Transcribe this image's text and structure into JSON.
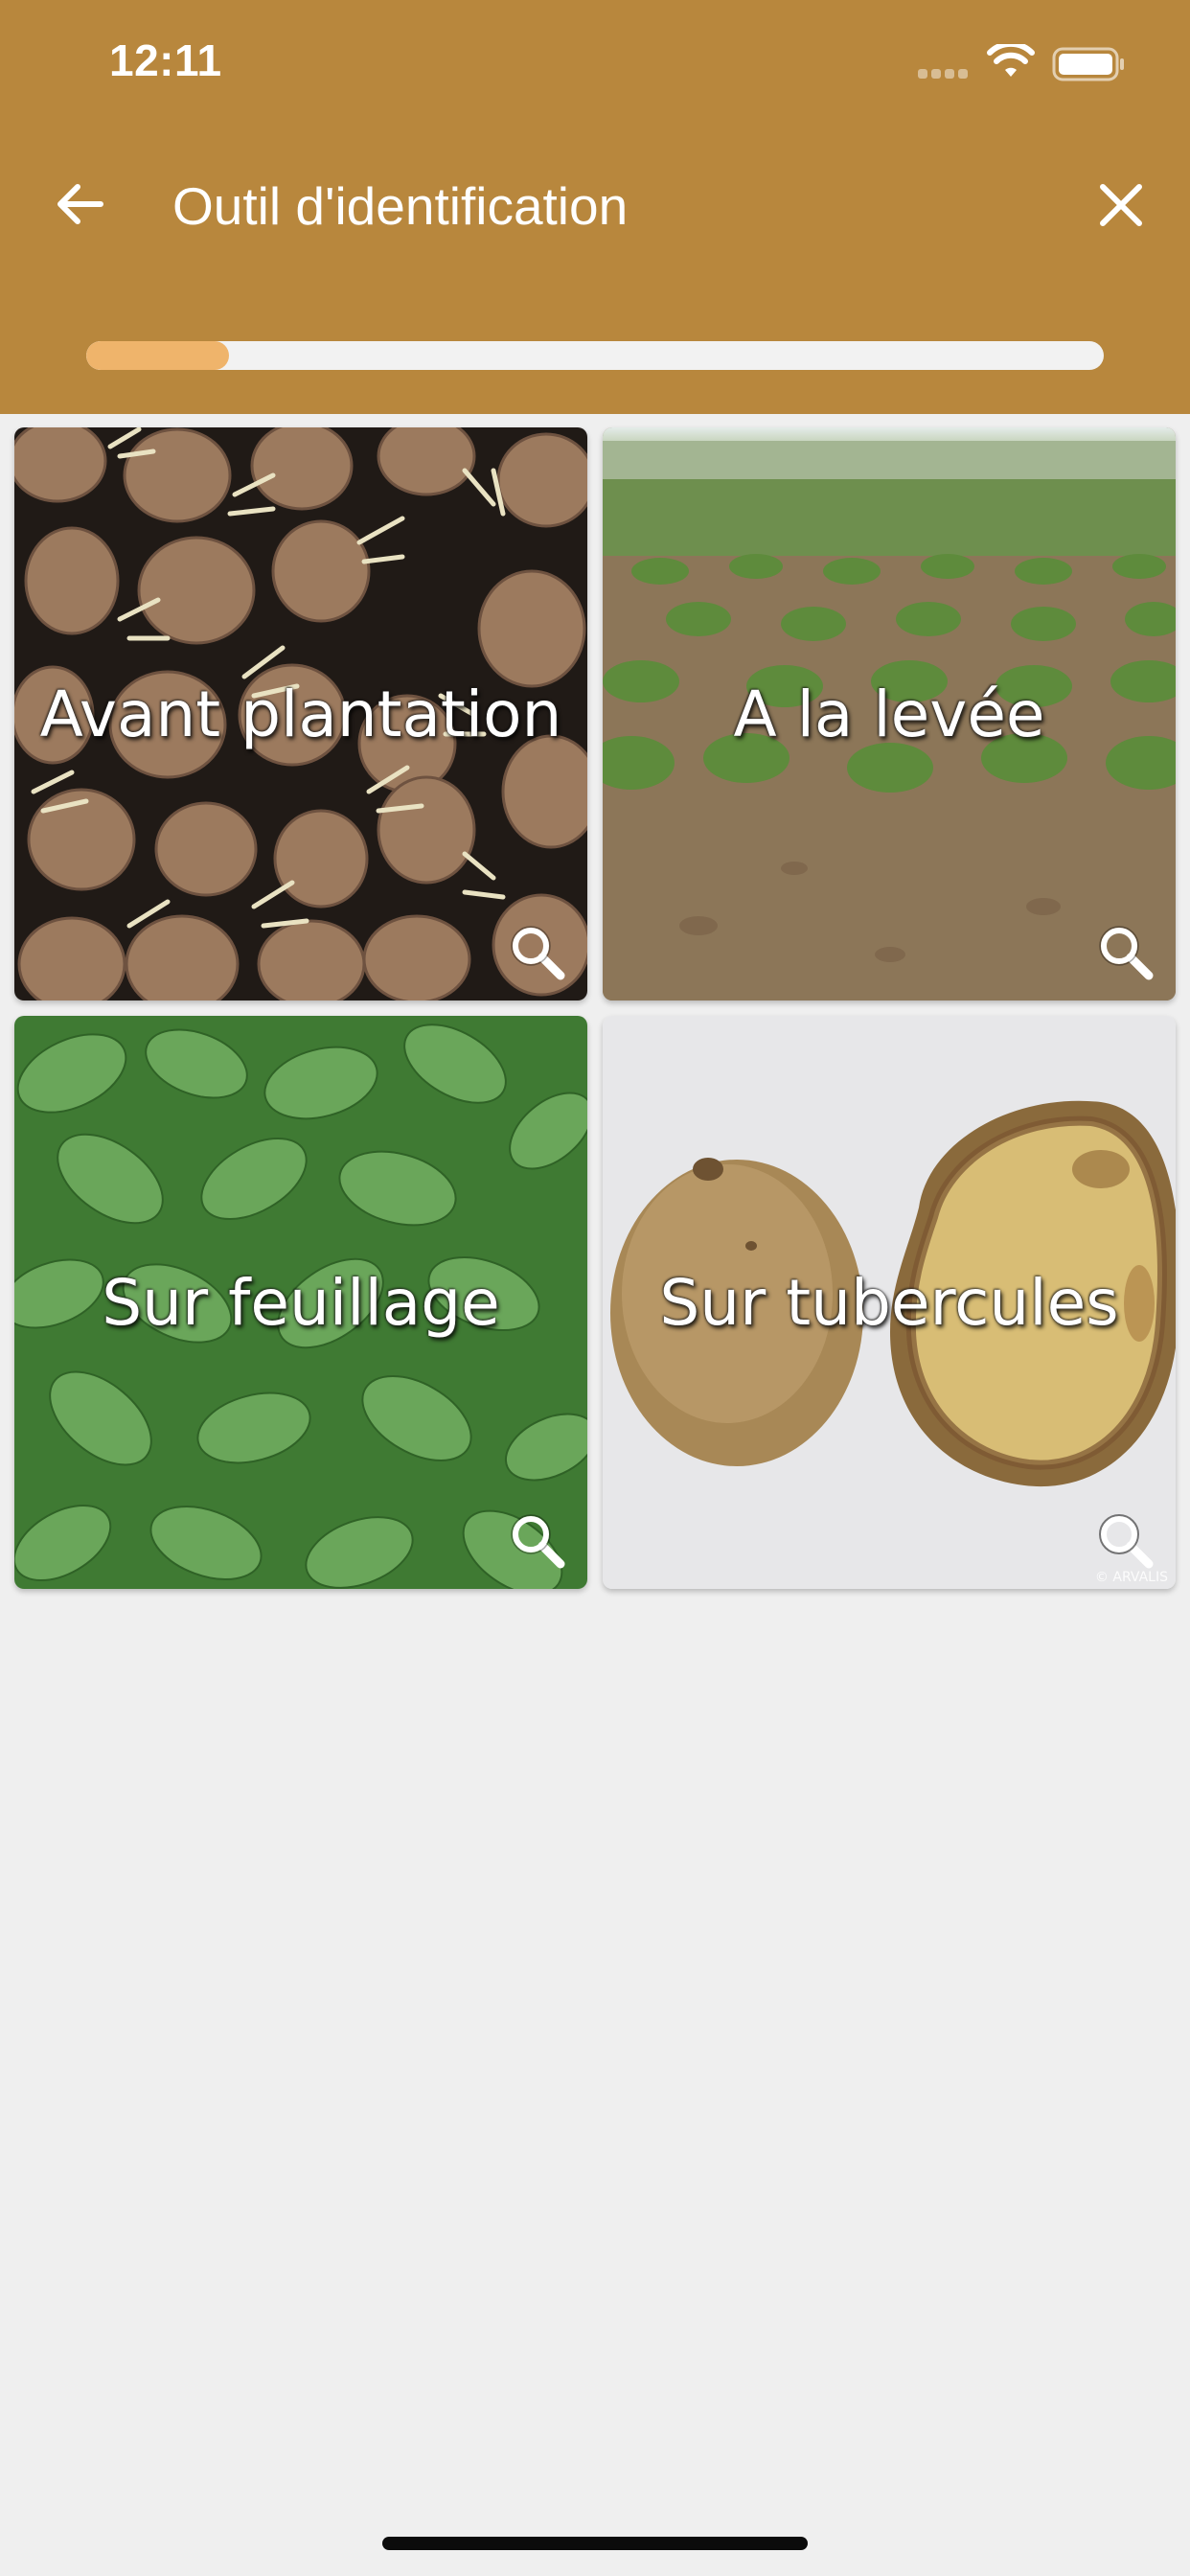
{
  "status_bar": {
    "time": "12:11",
    "signal_icon": "cellular-signal-icon",
    "wifi_icon": "wifi-icon",
    "battery_icon": "battery-icon"
  },
  "header": {
    "title": "Outil d'identification",
    "back_icon": "arrow-left-icon",
    "close_icon": "close-icon",
    "background_color": "#b8873d",
    "progress": {
      "value_fraction": 0.14,
      "fill_color": "#efb46b",
      "track_color": "#f2f2f2"
    }
  },
  "tiles": [
    {
      "label": "Avant plantation",
      "icon": "magnifier-icon"
    },
    {
      "label": "A la levée",
      "icon": "magnifier-icon"
    },
    {
      "label": "Sur feuillage",
      "icon": "magnifier-icon"
    },
    {
      "label": "Sur tubercules",
      "icon": "magnifier-icon",
      "credit": "© ARVALIS"
    }
  ],
  "colors": {
    "page_background": "#efefef",
    "tile_label_text": "#ffffff"
  }
}
